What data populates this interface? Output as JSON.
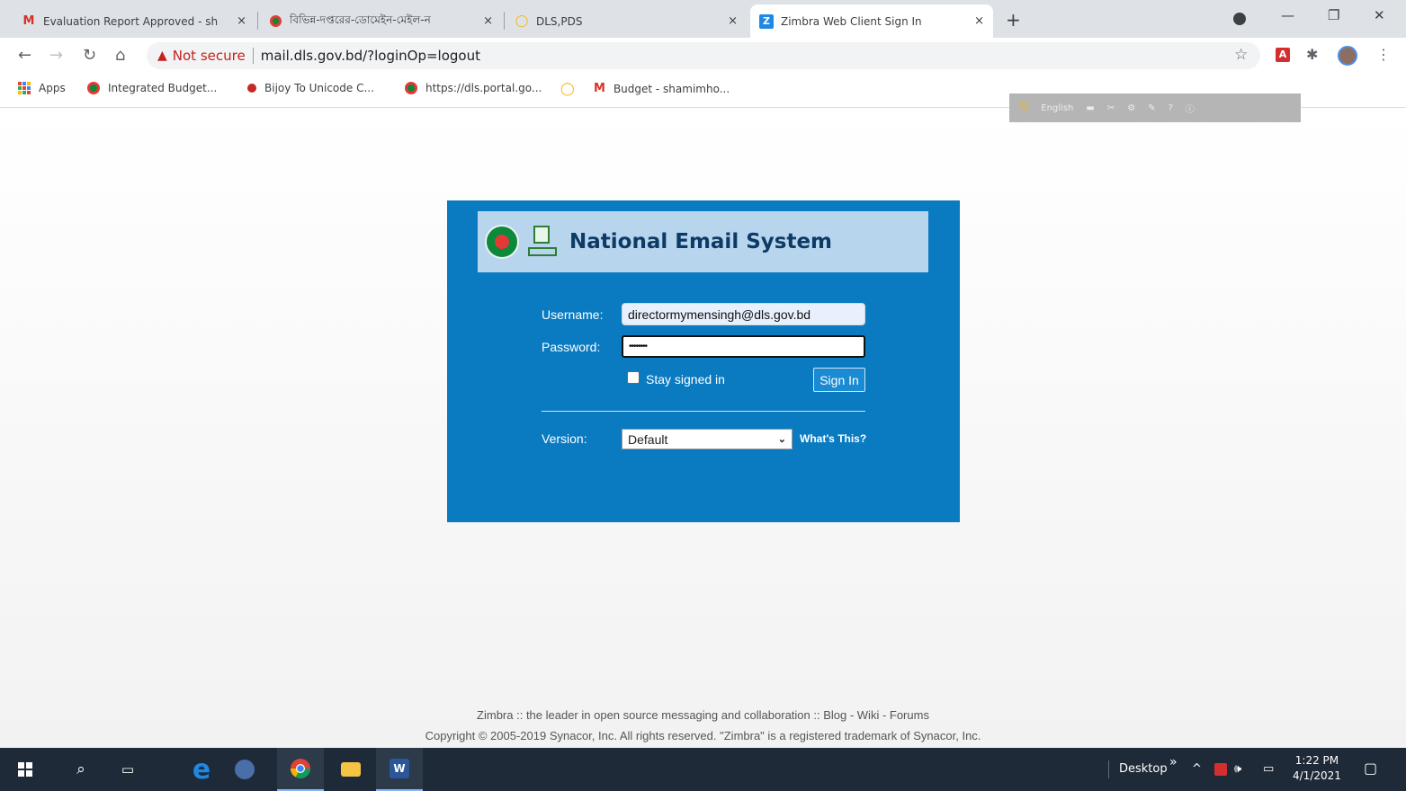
{
  "browser": {
    "tabs": [
      {
        "title": "Evaluation Report Approved - sh",
        "favicon": "gmail-icon",
        "active": false
      },
      {
        "title": "বিভিন্ন-দপ্তরের-ডোমেইন-মেইল-ন",
        "favicon": "gov-bd-icon",
        "active": false
      },
      {
        "title": "DLS,PDS",
        "favicon": "dls-icon",
        "active": false
      },
      {
        "title": "Zimbra Web Client Sign In",
        "favicon": "zimbra-icon",
        "active": true
      }
    ],
    "close_glyph": "×",
    "new_tab_glyph": "+",
    "security_label": "Not secure",
    "url": "mail.dls.gov.bd/?loginOp=logout",
    "bookmarks": [
      {
        "label": "Apps"
      },
      {
        "label": "Integrated Budget..."
      },
      {
        "label": "Bijoy To Unicode C..."
      },
      {
        "label": "https://dls.portal.go..."
      },
      {
        "label": ""
      },
      {
        "label": "Budget - shamimho..."
      }
    ]
  },
  "ime_bar": {
    "language": "English"
  },
  "login": {
    "banner_title": "National Email System",
    "username_label": "Username:",
    "username_value": "directormymensingh@dls.gov.bd",
    "password_label": "Password:",
    "password_value": "••••••••",
    "stay_signed_in": "Stay signed in",
    "sign_in_button": "Sign In",
    "version_label": "Version:",
    "version_selected": "Default",
    "whats_this": "What's This?"
  },
  "footer": {
    "line1": "Zimbra :: the leader in open source messaging and collaboration :: Blog - Wiki - Forums",
    "line2": "Copyright © 2005-2019 Synacor, Inc. All rights reserved. \"Zimbra\" is a registered trademark of Synacor, Inc."
  },
  "taskbar": {
    "desktop_label": "Desktop",
    "overflow": "»",
    "time": "1:22 PM",
    "date": "4/1/2021"
  },
  "colors": {
    "panel": "#0a7bc1",
    "banner": "#b8d5ee",
    "banner_text": "#0d3b66",
    "not_secure": "#c5221f"
  }
}
